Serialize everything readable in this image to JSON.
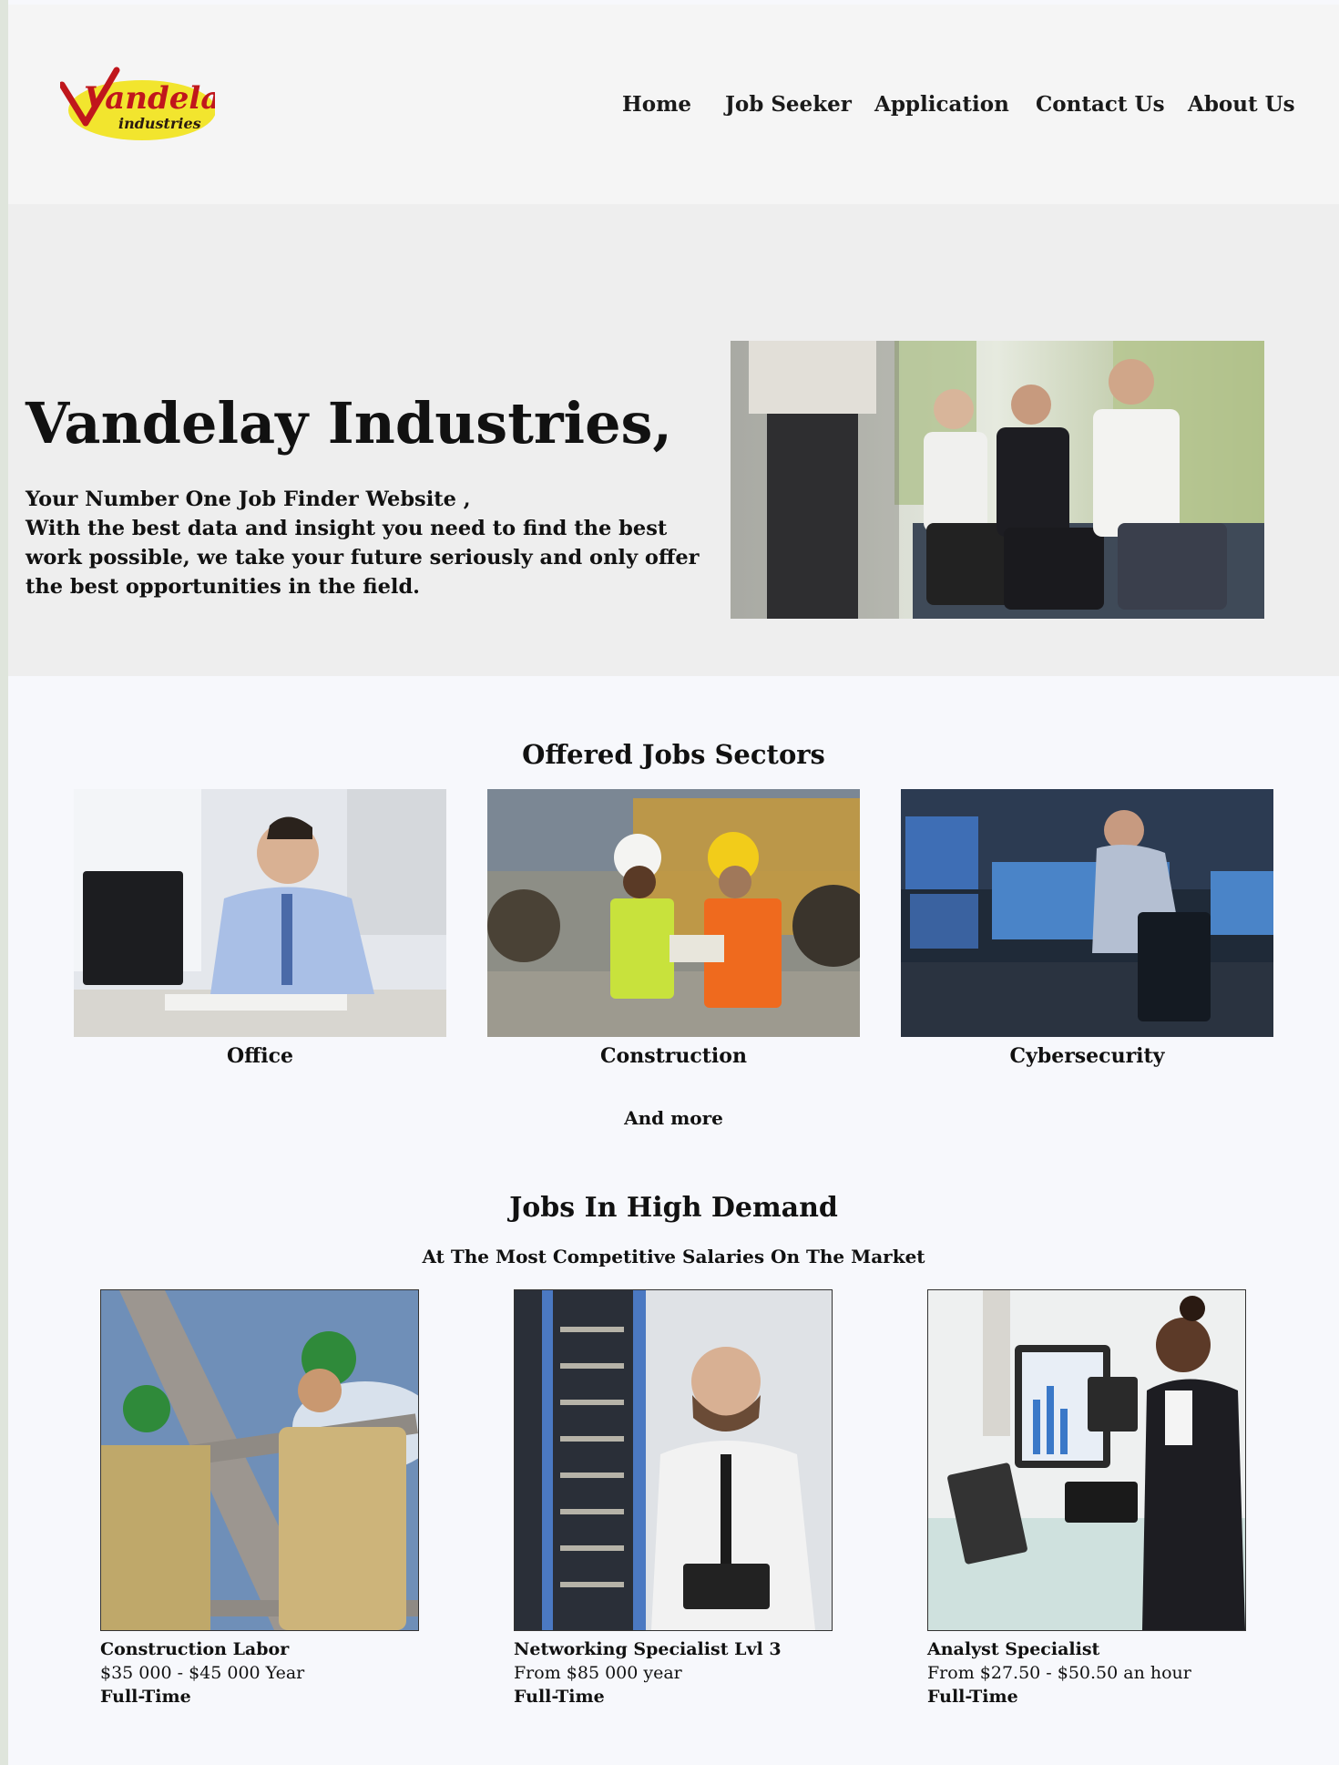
{
  "brand": {
    "logo_main": "Vandelay",
    "logo_sub": "industries"
  },
  "nav": {
    "items": [
      {
        "label": "Home"
      },
      {
        "label": "Job Seeker"
      },
      {
        "label": "Application"
      },
      {
        "label": "Contact Us"
      },
      {
        "label": "About Us"
      }
    ]
  },
  "hero": {
    "title": "Vandelay Industries,",
    "tagline": "Your Number One Job Finder Website ,",
    "description": "With the best data and insight you need to find the best work possible, we take your future seriously and only offer the best opportunities in the field."
  },
  "sectors": {
    "title": "Offered Jobs Sectors",
    "items": [
      {
        "label": "Office"
      },
      {
        "label": "Construction"
      },
      {
        "label": "Cybersecurity"
      }
    ],
    "more": "And more"
  },
  "jobs": {
    "title": "Jobs In High Demand",
    "subtitle": "At The Most Competitive Salaries On The Market",
    "items": [
      {
        "title": "Construction Labor",
        "salary": "$35 000 - $45 000 Year",
        "type": "Full-Time"
      },
      {
        "title": "Networking Specialist Lvl 3",
        "salary": "From $85 000 year",
        "type": "Full-Time"
      },
      {
        "title": "Analyst Specialist",
        "salary": "From $27.50 - $50.50 an hour",
        "type": "Full-Time"
      }
    ]
  },
  "colors": {
    "logo_yellow": "#f2e52e",
    "logo_red": "#c0161c",
    "hero_bg": "#eeeeee",
    "page_bg": "#f7f8fc"
  }
}
